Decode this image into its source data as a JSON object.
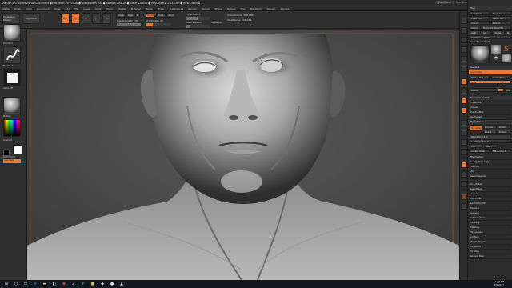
{
  "titlebar": {
    "title": "ZBrush 4R7 64-bit   ZBrushDocument   ●Free Mem 29.979GB ● Active Mem 397 ● Scratch Disk 28 ● Timer ►0.011 ● PolyCount ► 2.024 MP ● MeshCount ► 1",
    "quicksave": "QuickSave",
    "see_through": "See-through 0",
    "menus": "Menus",
    "default_script": "DefaultZScript"
  },
  "menubar": {
    "items": [
      "Alpha",
      "Brush",
      "Color",
      "Document",
      "Draw",
      "Edit",
      "File",
      "Layer",
      "Light",
      "Macro",
      "Marker",
      "Material",
      "Movie",
      "Picker",
      "Preferences",
      "Render",
      "Stencil",
      "Stroke",
      "Texture",
      "Tool",
      "Transform",
      "Zplugin",
      "Zscript"
    ]
  },
  "shelf": {
    "projection_master": "Projection Master",
    "lightbox": "LightBox",
    "edit": "Edit",
    "draw": "Draw",
    "move": "Move",
    "scale": "Scale",
    "rotate": "Rotate",
    "mrgb": "Mrgb",
    "rgb": "Rgb",
    "m": "M",
    "zadd": "Zadd",
    "zsub": "Zsub",
    "zcut": "Zcut",
    "focal_shift": "Focal Shift 0",
    "draw_size": "Draw Size 64",
    "dynamic": "Dynamic",
    "rgb_intensity": "Rgb Intensity 100",
    "z_intensity": "Z Intensity 25",
    "active_points": "ActivePoints: 508,062",
    "total_points": "TotalPoints: 508,062"
  },
  "leftbar": {
    "standard_brush": "Standard",
    "stroke": "FreeHand",
    "alpha": "Alpha Off",
    "material": "MatCap",
    "gradient": "Gradient",
    "switch_color": "SwitchColor",
    "alternate": "Alternate"
  },
  "tray": {
    "load_tool": "Load Tool",
    "save_as": "Save As",
    "copy_tool": "Copy Tool",
    "paste_tool": "Paste Tool",
    "import": "Import",
    "export": "Export",
    "clone": "Clone",
    "make_polymesh": "Make PolyMesh3D",
    "goz": "GoZ",
    "all": "All",
    "visible": "Visible",
    "r": "R",
    "lightbox_tools": "Lightbox ► Tools",
    "tool_name": "DemoHead.ztl 46",
    "subtool": "Subtool",
    "geometry": "Geometry",
    "higher_res": "Higher Res",
    "lower_res": "Lower Res",
    "divide": "Divide",
    "smt": "Smt",
    "suv": "Suv",
    "dynamic_subdiv": "Dynamic Subdiv",
    "edgeloop": "EdgeLoop",
    "crease": "Crease",
    "shadowbox": "ShadowBox",
    "claypolish": "ClayPolish",
    "dynamesh": "DynaMesh",
    "dynamesh_btn": "DynaMesh",
    "groups": "Groups",
    "polish": "Polish",
    "blur": "Blur 2",
    "project": "Project",
    "resolution": "Resolution 512",
    "subprojection": "SubProjection 0.6",
    "add": "Add",
    "sub": "Sub",
    "create_shell": "Create Shell",
    "thickness": "Thickness 4",
    "zremesher": "ZRemesher",
    "modify_topology": "Modify Topology",
    "position": "Position",
    "size": "Size",
    "meshintegrity": "MeshIntegrity",
    "sections": [
      "ArrayMesh",
      "NanoMesh",
      "Layers",
      "FiberMesh",
      "Geometry HD",
      "Preview",
      "Surface",
      "Deformation",
      "Masking",
      "Visibility",
      "Polygroups",
      "Contact",
      "Morph Target",
      "Polypaint",
      "UV Map",
      "Texture Map"
    ]
  },
  "taskbar": {
    "time": "11:33 AM",
    "date": "5/8/2017"
  },
  "colors": {
    "accent": "#e8793a",
    "panel": "#2b2b2b",
    "canvas": "#454545",
    "taskbar": "#121820"
  }
}
